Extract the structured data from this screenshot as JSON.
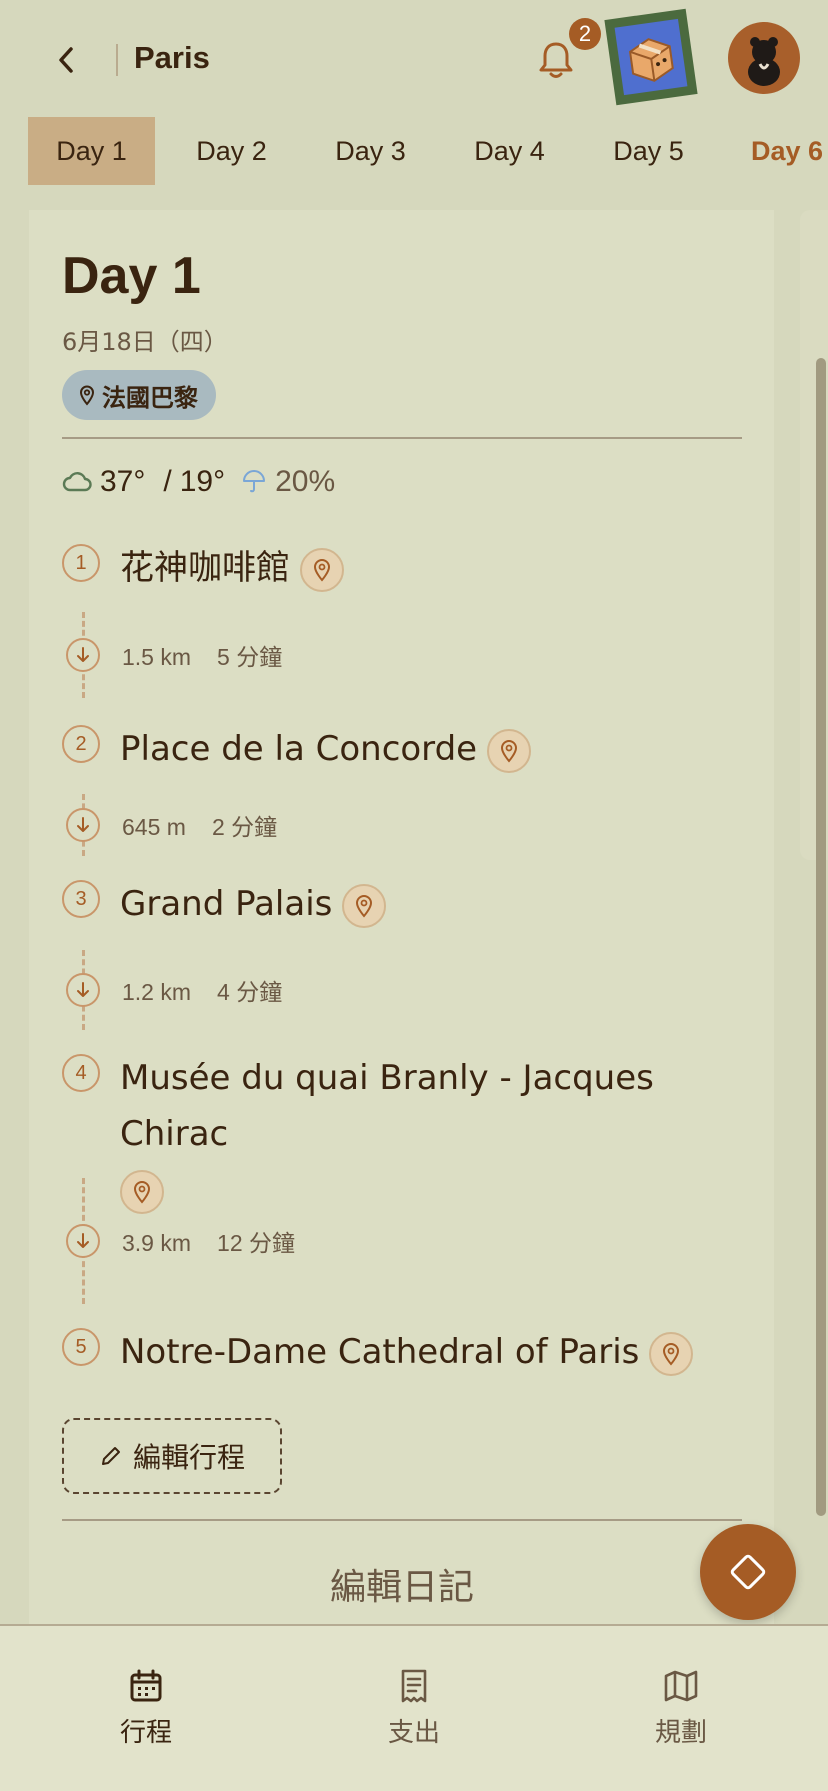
{
  "header": {
    "title": "Paris",
    "notification_count": "2"
  },
  "tabs": [
    {
      "label": "Day 1"
    },
    {
      "label": "Day 2"
    },
    {
      "label": "Day 3"
    },
    {
      "label": "Day 4"
    },
    {
      "label": "Day 5"
    },
    {
      "label": "Day 6"
    }
  ],
  "day": {
    "title": "Day 1",
    "date": "6月18日（四）",
    "location": "法國巴黎"
  },
  "weather": {
    "high": "37°",
    "separator": "/",
    "low": "19°",
    "rain_chance": "20%"
  },
  "stops": [
    {
      "num": "1",
      "name": "花神咖啡館"
    },
    {
      "num": "2",
      "name": "Place de la Concorde"
    },
    {
      "num": "3",
      "name": "Grand Palais"
    },
    {
      "num": "4",
      "name": "Musée du quai Branly - Jacques Chirac"
    },
    {
      "num": "5",
      "name": "Notre-Dame Cathedral of Paris"
    }
  ],
  "legs": [
    {
      "distance": "1.5 km",
      "duration": "5 分鐘"
    },
    {
      "distance": "645 m",
      "duration": "2 分鐘"
    },
    {
      "distance": "1.2 km",
      "duration": "4 分鐘"
    },
    {
      "distance": "3.9 km",
      "duration": "12 分鐘"
    }
  ],
  "actions": {
    "edit_itinerary": "編輯行程",
    "edit_diary": "編輯日記"
  },
  "bottom_nav": [
    {
      "label": "行程",
      "icon": "calendar-icon"
    },
    {
      "label": "支出",
      "icon": "receipt-icon"
    },
    {
      "label": "規劃",
      "icon": "map-icon"
    }
  ],
  "colors": {
    "background": "#d6d8bd",
    "accent": "#a55c25",
    "active_tab": "#c9ad85",
    "location_chip": "#a9bac0"
  }
}
